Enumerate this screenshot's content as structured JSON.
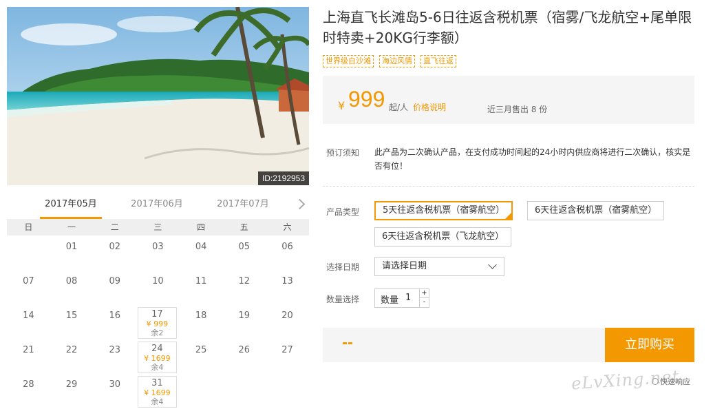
{
  "photo": {
    "id_badge": "ID:2192953"
  },
  "calendar": {
    "tabs": [
      "2017年05月",
      "2017年06月",
      "2017年07月"
    ],
    "active_tab": 0,
    "weekdays": [
      "日",
      "一",
      "二",
      "三",
      "四",
      "五",
      "六"
    ],
    "cells": [
      {
        "d": ""
      },
      {
        "d": "01"
      },
      {
        "d": "02"
      },
      {
        "d": "03"
      },
      {
        "d": "04"
      },
      {
        "d": "05"
      },
      {
        "d": "06"
      },
      {
        "d": "07"
      },
      {
        "d": "08"
      },
      {
        "d": "09"
      },
      {
        "d": "10"
      },
      {
        "d": "11"
      },
      {
        "d": "12"
      },
      {
        "d": "13"
      },
      {
        "d": "14"
      },
      {
        "d": "15"
      },
      {
        "d": "16"
      },
      {
        "d": "17",
        "price": "¥ 999",
        "stock": "余2"
      },
      {
        "d": "18"
      },
      {
        "d": "19"
      },
      {
        "d": "20"
      },
      {
        "d": "21"
      },
      {
        "d": "22"
      },
      {
        "d": "23"
      },
      {
        "d": "24",
        "price": "¥ 1699",
        "stock": "余4"
      },
      {
        "d": "25"
      },
      {
        "d": "26"
      },
      {
        "d": "27"
      },
      {
        "d": "28"
      },
      {
        "d": "29"
      },
      {
        "d": "30"
      },
      {
        "d": "31",
        "price": "¥ 1699",
        "stock": "余4"
      },
      {
        "d": ""
      },
      {
        "d": ""
      },
      {
        "d": ""
      }
    ]
  },
  "product": {
    "title": "上海直飞长滩岛5-6日往返含税机票（宿雾/飞龙航空+尾单限时特卖+20KG行李额）",
    "tags": [
      "世界级白沙滩",
      "海边风情",
      "直飞往返"
    ],
    "price_symbol": "¥",
    "price": "999",
    "per_person": "起/人",
    "price_note": "价格说明",
    "sold": "近三月售出 8 份",
    "notice_label": "预订须知",
    "notice_text": "此产品为二次确认产品，在支付成功时间起的24小时内供应商将进行二次确认，核实是否有位！",
    "type_label": "产品类型",
    "options": [
      "5天往返含税机票（宿雾航空）",
      "6天往返含税机票（宿雾航空）",
      "6天往返含税机票（飞龙航空）"
    ],
    "selected_option": 0,
    "date_label": "选择日期",
    "date_placeholder": "请选择日期",
    "qty_label": "数量选择",
    "qty_text": "数量",
    "qty_value": "1",
    "qty_plus": "+",
    "qty_minus": "-",
    "total": "--",
    "buy_label": "立即购买"
  },
  "footer": {
    "quick_response": "快速响应",
    "watermark": "eLvXing.net"
  },
  "colors": {
    "accent": "#f39800",
    "panel": "#f5f5f5"
  }
}
